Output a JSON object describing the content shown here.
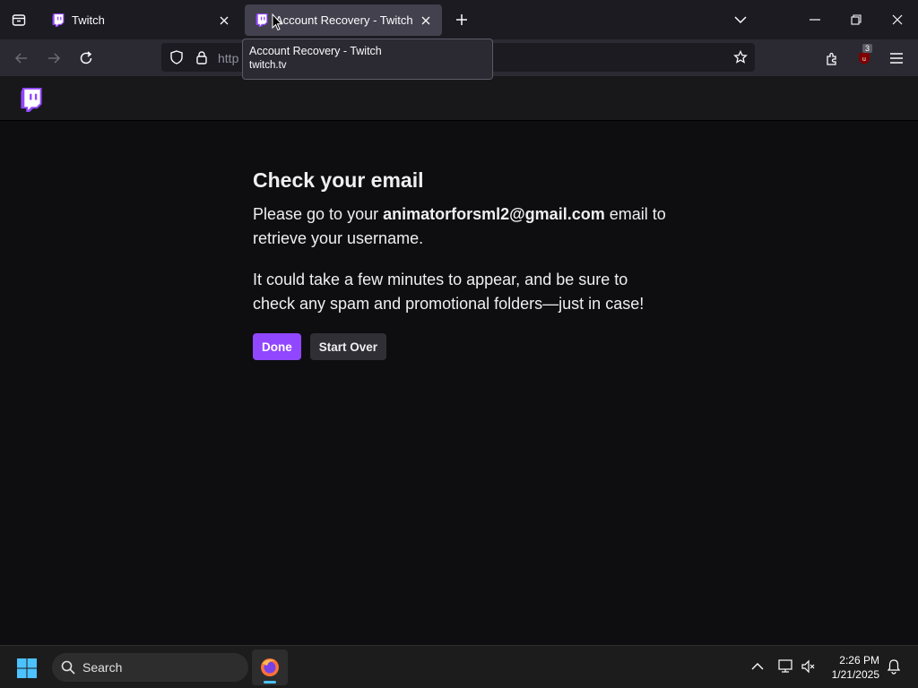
{
  "browser": {
    "tabs": [
      {
        "title": "Twitch",
        "active": false
      },
      {
        "title": "Account Recovery - Twitch",
        "active": true
      }
    ],
    "url_partial": "http",
    "tooltip": {
      "title": "Account Recovery - Twitch",
      "domain": "twitch.tv"
    },
    "extension_badge": "3"
  },
  "page": {
    "heading": "Check your email",
    "para1_prefix": "Please go to your ",
    "para1_email": "animatorforsml2@gmail.com",
    "para1_suffix": " email to retrieve your username.",
    "para2": "It could take a few minutes to appear, and be sure to check any spam and promotional folders—just in case!",
    "done_label": "Done",
    "start_over_label": "Start Over"
  },
  "taskbar": {
    "search_label": "Search",
    "time": "2:26 PM",
    "date": "1/21/2025"
  },
  "colors": {
    "accent": "#9147ff",
    "background": "#0e0e10",
    "topnav": "#18181b"
  }
}
